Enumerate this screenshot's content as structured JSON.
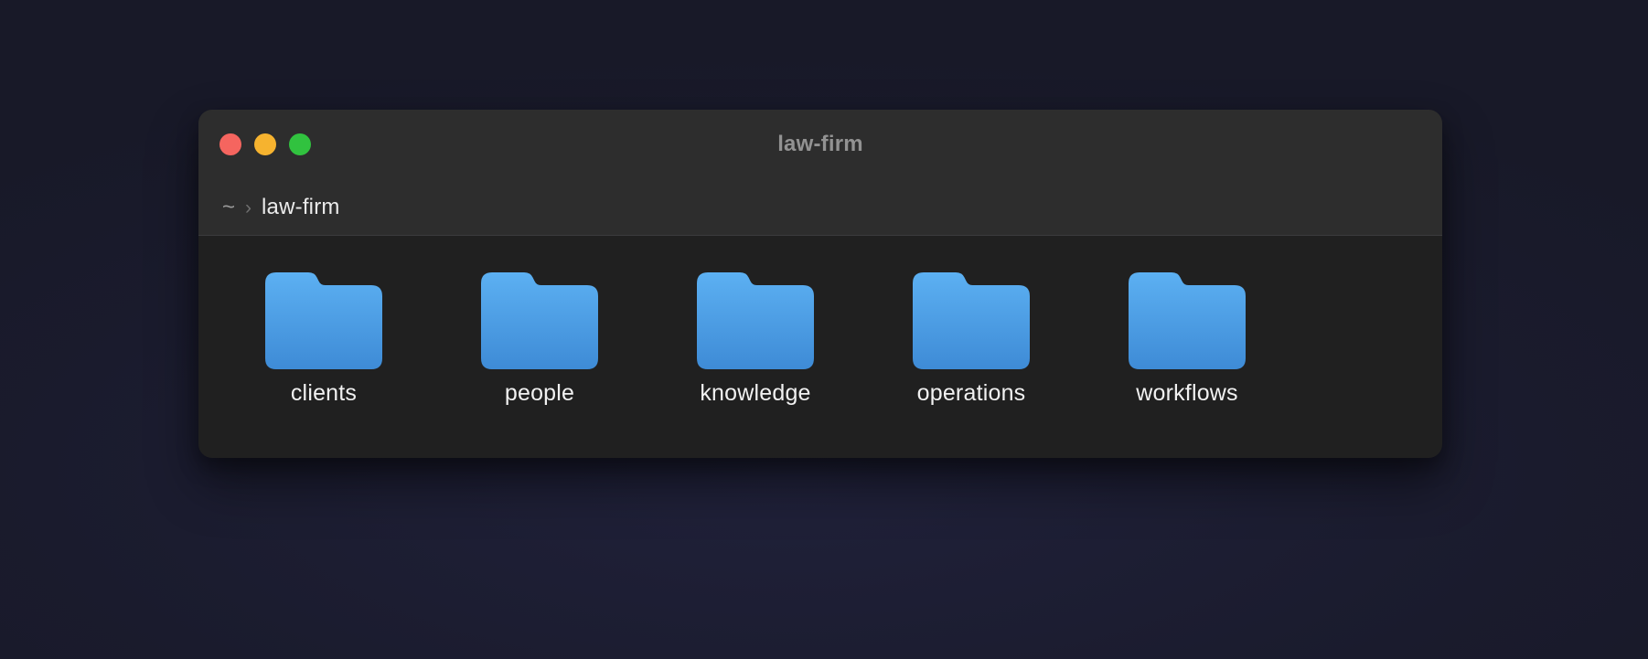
{
  "window": {
    "title": "law-firm",
    "path": {
      "root": "~",
      "separator": "›",
      "current": "law-firm"
    }
  },
  "traffic_lights": [
    {
      "name": "close-button",
      "color": "#f5655f"
    },
    {
      "name": "minimize-button",
      "color": "#f6b32f"
    },
    {
      "name": "zoom-button",
      "color": "#31c23f"
    }
  ],
  "folders": [
    {
      "label": "clients"
    },
    {
      "label": "people"
    },
    {
      "label": "knowledge"
    },
    {
      "label": "operations"
    },
    {
      "label": "workflows"
    }
  ],
  "colors": {
    "desktop_bg": "#1a1b2d",
    "bg_glow": "#20213a",
    "window_header": "#2d2d2d",
    "window_content": "#202020",
    "folder_top": "#5cb0f2",
    "folder_bottom": "#3e8bd6"
  }
}
